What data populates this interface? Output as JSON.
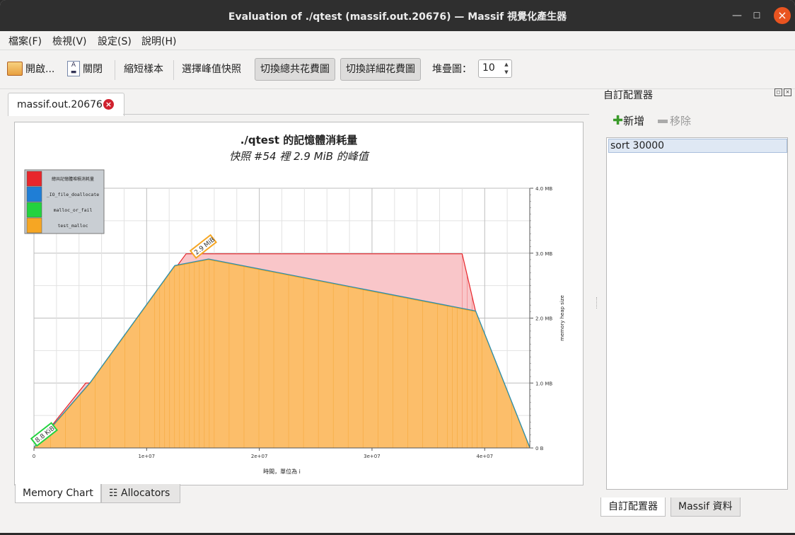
{
  "window": {
    "title": "Evaluation of ./qtest (massif.out.20676) — Massif 視覺化產生器"
  },
  "menu": [
    "檔案(F)",
    "檢視(V)",
    "設定(S)",
    "說明(H)"
  ],
  "toolbar": {
    "open": "開啟...",
    "close": "關閉",
    "shorten": "縮短樣本",
    "select_peak": "選擇峰值快照",
    "toggle_total": "切換總共花費圖",
    "toggle_detail": "切換詳細花費圖",
    "stack_label": "堆疊圖：",
    "stack_value": "10"
  },
  "doc_tab": {
    "label": "massif.out.20676"
  },
  "bottom_tabs": {
    "memory_chart": "Memory Chart",
    "allocators": "Allocators"
  },
  "right_pane": {
    "title": "自訂配置器",
    "add": "新增",
    "remove": "移除",
    "items": [
      "sort 30000"
    ],
    "tab_allocators": "自訂配置器",
    "tab_massif": "Massif 資料"
  },
  "chart_data": {
    "type": "area",
    "title": "./qtest 的記憶體消耗量",
    "subtitle": "快照 #54 裡 2.9 MiB 的峰值",
    "xlabel": "時間，單位為 i",
    "ylabel": "memory heap size",
    "xlim": [
      0,
      44000000
    ],
    "ylim": [
      0,
      4.0
    ],
    "x_ticks": [
      "0",
      "1e+07",
      "2e+07",
      "3e+07",
      "4e+07"
    ],
    "y_ticks": [
      "0 B",
      "1.0 MB",
      "2.0 MB",
      "3.0 MB",
      "4.0 MB"
    ],
    "legend_position": "top-left",
    "series": [
      {
        "name": "總共記憶體堆積消耗量",
        "color": "#e8262b",
        "fill": "#f9c6c9",
        "x": [
          0,
          4600000,
          5000000,
          13500000,
          15500000,
          38000000,
          39200000,
          44000000
        ],
        "y": [
          0,
          1.0,
          1.0,
          2.99,
          2.99,
          2.99,
          2.1,
          0
        ]
      },
      {
        "name": "_IO_file_doallocate",
        "color": "#1f7ed6",
        "fill": "#1f7ed6",
        "x": [
          0,
          44000000
        ],
        "y": [
          0.005,
          0.005
        ]
      },
      {
        "name": "malloc_or_fail",
        "color": "#23d23f",
        "fill": "#23d23f",
        "x": [
          0,
          44000000
        ],
        "y": [
          0.002,
          0.002
        ]
      },
      {
        "name": "test_malloc",
        "color": "#f6a623",
        "fill": "#fcbe6a",
        "x": [
          0,
          5000000,
          12500000,
          15500000,
          39200000,
          44000000
        ],
        "y": [
          0,
          1.0,
          2.8,
          2.9,
          2.1,
          0
        ]
      }
    ],
    "annotations": [
      {
        "label": "2.9 MiB",
        "x": 15500000,
        "y": 2.9,
        "color": "#f6a623"
      },
      {
        "label": "8.8 KiB",
        "x": 1000000,
        "y": 0.05,
        "color": "#23d23f"
      }
    ]
  }
}
